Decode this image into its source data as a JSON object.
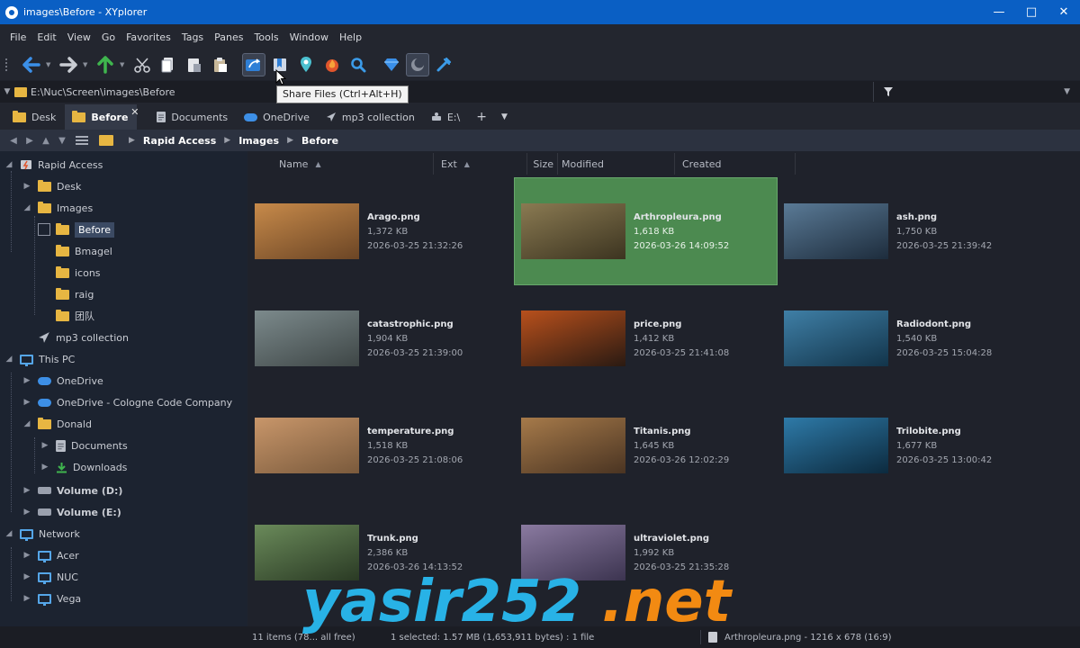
{
  "window": {
    "title": "images\\Before - XYplorer",
    "controls": [
      "minimize",
      "maximize",
      "close"
    ]
  },
  "menu": [
    "File",
    "Edit",
    "View",
    "Go",
    "Favorites",
    "Tags",
    "Panes",
    "Tools",
    "Window",
    "Help"
  ],
  "toolbar": {
    "tooltip": "Share Files (Ctrl+Alt+H)",
    "buttons": [
      "back-icon",
      "forward-icon",
      "up-icon",
      "cut-icon",
      "copy-icon",
      "paste-icon",
      "paste-special-icon",
      "share-files-icon",
      "bookmark-icon",
      "location-icon",
      "burn-icon",
      "search-icon",
      "diamond-icon",
      "moon-icon",
      "tools-icon"
    ]
  },
  "address": {
    "path": "E:\\Nuc\\Screen\\images\\Before"
  },
  "tabs": [
    {
      "label": "Desk",
      "icon": "folder"
    },
    {
      "label": "Before",
      "icon": "folder",
      "active": true
    },
    {
      "label": "Documents",
      "icon": "document"
    },
    {
      "label": "OneDrive",
      "icon": "cloud"
    },
    {
      "label": "mp3 collection",
      "icon": "pin"
    },
    {
      "label": "E:\\",
      "icon": "drive"
    }
  ],
  "breadcrumb": [
    "Rapid Access",
    "Images",
    "Before"
  ],
  "tree": [
    {
      "label": "Rapid Access",
      "level": 0
    },
    {
      "label": "Desk",
      "level": 1
    },
    {
      "label": "Images",
      "level": 1
    },
    {
      "label": "Before",
      "level": 2,
      "selected": true
    },
    {
      "label": "Bmagel",
      "level": 2
    },
    {
      "label": "icons",
      "level": 2
    },
    {
      "label": "raig",
      "level": 2
    },
    {
      "label": "团队",
      "level": 2
    },
    {
      "label": "mp3 collection",
      "level": 1
    },
    {
      "label": "This PC",
      "level": 0
    },
    {
      "label": "OneDrive",
      "level": 1
    },
    {
      "label": "OneDrive - Cologne Code Company",
      "level": 1
    },
    {
      "label": "Donald",
      "level": 1
    },
    {
      "label": "Documents",
      "level": 2
    },
    {
      "label": "Downloads",
      "level": 2
    },
    {
      "label": "Volume (D:)",
      "level": 1
    },
    {
      "label": "Volume (E:)",
      "level": 1
    },
    {
      "label": "Network",
      "level": 0
    },
    {
      "label": "Acer",
      "level": 1
    },
    {
      "label": "NUC",
      "level": 1
    },
    {
      "label": "Vega",
      "level": 1
    }
  ],
  "columns": [
    "Name",
    "Ext",
    "Size",
    "Modified",
    "Created"
  ],
  "files": [
    {
      "name": "Arago.png",
      "size": "1,372 KB",
      "date": "2026-03-25 21:32:26",
      "colors": [
        "#c78a4a",
        "#6b4525"
      ]
    },
    {
      "name": "Arthropleura.png",
      "size": "1,618 KB",
      "date": "2026-03-26 14:09:52",
      "colors": [
        "#8a7a52",
        "#3c3420"
      ],
      "selected": true
    },
    {
      "name": "ash.png",
      "size": "1,750 KB",
      "date": "2026-03-25 21:39:42",
      "colors": [
        "#5a7a96",
        "#1d2c3c"
      ]
    },
    {
      "name": "catastrophic.png",
      "size": "1,904 KB",
      "date": "2026-03-25 21:39:00",
      "colors": [
        "#7c8a8c",
        "#3e4646"
      ]
    },
    {
      "name": "price.png",
      "size": "1,412 KB",
      "date": "2026-03-25 21:41:08",
      "colors": [
        "#b8501c",
        "#2a1a12"
      ]
    },
    {
      "name": "Radiodont.png",
      "size": "1,540 KB",
      "date": "2026-03-25 15:04:28",
      "colors": [
        "#3f7fa6",
        "#12344a"
      ]
    },
    {
      "name": "temperature.png",
      "size": "1,518 KB",
      "date": "2026-03-25 21:08:06",
      "colors": [
        "#c8966a",
        "#7a5a3c"
      ]
    },
    {
      "name": "Titanis.png",
      "size": "1,645 KB",
      "date": "2026-03-26 12:02:29",
      "colors": [
        "#a67a4a",
        "#4a3422"
      ]
    },
    {
      "name": "Trilobite.png",
      "size": "1,677 KB",
      "date": "2026-03-25 13:00:42",
      "colors": [
        "#2e7aa8",
        "#0c2a3e"
      ]
    },
    {
      "name": "Trunk.png",
      "size": "2,386 KB",
      "date": "2026-03-26 14:13:52",
      "colors": [
        "#6a8a5a",
        "#2a3a24"
      ]
    },
    {
      "name": "ultraviolet.png",
      "size": "1,992 KB",
      "date": "2026-03-25 21:35:28",
      "colors": [
        "#8a7aa0",
        "#3c3450"
      ]
    }
  ],
  "status": {
    "items": "11 items (78... all free)",
    "selection": "1 selected: 1.57 MB (1,653,911 bytes) : 1 file",
    "preview": "Arthropleura.png - 1216 x 678 (16:9)"
  },
  "watermark": {
    "part1": "yasir252",
    "part2": " .net"
  },
  "colors": {
    "titlebar": "#0a5fc4",
    "selection": "#4c8a50",
    "folder": "#e7b642"
  }
}
